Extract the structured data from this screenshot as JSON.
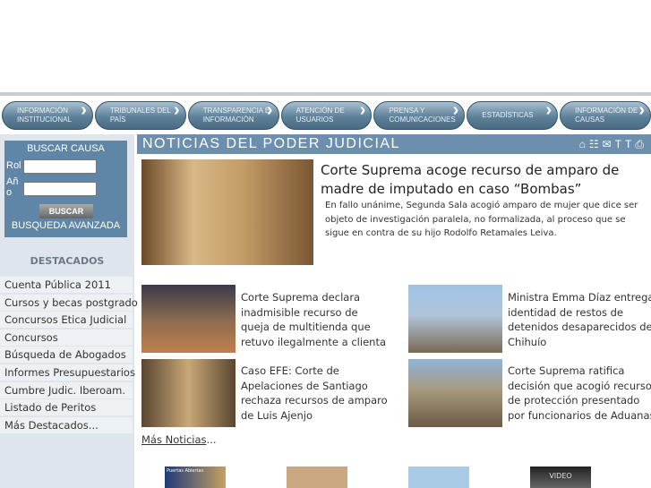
{
  "nav": [
    {
      "label": "Información Institucional"
    },
    {
      "label": "Tribunales del País"
    },
    {
      "label": "Transparencia e Información"
    },
    {
      "label": "Atención de Usuarios"
    },
    {
      "label": "Prensa y Comunicaciones"
    },
    {
      "label": "Estadísticas"
    },
    {
      "label": "Información de Causas"
    }
  ],
  "search": {
    "title": "BUSCAR CAUSA",
    "rol_label": "Rol",
    "ano_label": "Año",
    "button": "BUSCAR",
    "advanced": "BUSQUEDA AVANZADA"
  },
  "destacados": {
    "title": "DESTACADOS",
    "items": [
      "Cuenta Pública 2011",
      "Cursos y becas postgrado",
      "Concursos Etica Judicial",
      "Concursos",
      "Búsqueda de Abogados",
      "Informes Presupuestarios",
      "Cumbre Judic. Iberoam.",
      "Listado de Peritos",
      "Más Destacados..."
    ]
  },
  "header": {
    "title": "NOTICIAS DEL PODER JUDICIAL"
  },
  "featured": {
    "title": "Corte Suprema acoge recurso de amparo de madre de imputado en caso “Bombas”",
    "summary": "En fallo unánime, Segunda Sala acogió amparo de mujer que dice ser objeto de investigación paralela, no formalizada, al proceso que se sigue en contra de su hijo Rodolfo Retamales Leiva."
  },
  "news": [
    {
      "text": "Corte Suprema declara inadmisible recurso de queja de multitienda que retuvo ilegalmente a clienta"
    },
    {
      "text": "Ministra Emma Díaz entrega identidad de restos de detenidos desaparecidos de Chihuío"
    },
    {
      "text": "Caso EFE: Corte de Apelaciones de Santiago rechaza recursos de amparo de Luis Ajenjo"
    },
    {
      "text": "Corte Suprema ratifica decisión que acogió recurso de protección presentado por funcionarios de Aduanas"
    }
  ],
  "more": {
    "link": "Más Noticias",
    "suffix": "..."
  },
  "bottom": [
    {
      "label": "Puertas Abiertas"
    },
    {
      "label": ""
    },
    {
      "label": ""
    },
    {
      "label": "VIDEO"
    }
  ]
}
